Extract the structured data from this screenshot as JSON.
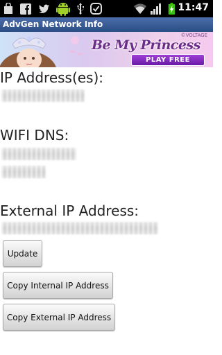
{
  "status_bar": {
    "time": "11:47",
    "icons": [
      "shopping-bag-icon",
      "facebook-icon",
      "twitter-icon",
      "android-icon",
      "usb-icon",
      "sync-icon",
      "wifi-icon",
      "signal-icon",
      "battery-charging-icon"
    ],
    "battery_color": "#39c20b"
  },
  "app": {
    "title": "AdvGen Network Info",
    "title_bar_color": "#2a4d86"
  },
  "ad": {
    "logo_text": "Be My Princess",
    "brand": "©VOLTAGE",
    "cta": "PLAY FREE"
  },
  "sections": {
    "ip_label": "IP Address(es):",
    "wifi_dns_label": "WIFI DNS:",
    "external_label": "External IP Address:"
  },
  "buttons": {
    "update": "Update",
    "copy_internal": "Copy Internal IP Address",
    "copy_external": "Copy External IP Address"
  }
}
